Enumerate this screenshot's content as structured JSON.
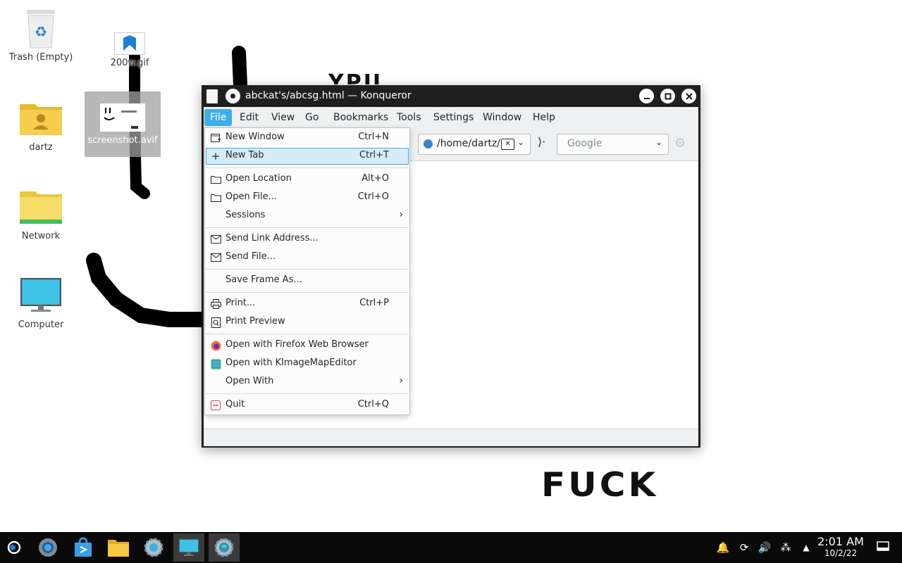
{
  "desktop": {
    "icons": [
      {
        "label": "Trash (Empty)",
        "icon": "trash-icon"
      },
      {
        "label": "200w.gif",
        "icon": "image-file-icon"
      },
      {
        "label": "screenshot.avif",
        "icon": "image-thumbnail-icon"
      },
      {
        "label": "dartz",
        "icon": "home-folder-icon"
      },
      {
        "label": "Network",
        "icon": "network-folder-icon"
      },
      {
        "label": "Computer",
        "icon": "computer-icon"
      }
    ],
    "wallpaper_text_top": "YPU",
    "wallpaper_text_bottom": "FUCK"
  },
  "window": {
    "title": "abckat's/abcsg.html — Konqueror",
    "menubar": [
      "File",
      "Edit",
      "View",
      "Go",
      "Bookmarks",
      "Tools",
      "Settings",
      "Window",
      "Help"
    ],
    "active_menu": "File",
    "location_value": "/home/dartz/D",
    "search_placeholder": "Google"
  },
  "file_menu": {
    "items": [
      {
        "label": "New Window",
        "shortcut": "Ctrl+N",
        "icon": "new-window-icon"
      },
      {
        "label": "New Tab",
        "shortcut": "Ctrl+T",
        "icon": "plus-icon"
      },
      {
        "label": "Open Location",
        "shortcut": "Alt+O",
        "icon": "folder-icon"
      },
      {
        "label": "Open File...",
        "shortcut": "Ctrl+O",
        "icon": "folder-icon"
      },
      {
        "label": "Sessions",
        "shortcut": "",
        "icon": ""
      },
      {
        "label": "Send Link Address...",
        "shortcut": "",
        "icon": "mail-link-icon"
      },
      {
        "label": "Send File...",
        "shortcut": "",
        "icon": "mail-file-icon"
      },
      {
        "label": "Save Frame As...",
        "shortcut": "",
        "icon": ""
      },
      {
        "label": "Print...",
        "shortcut": "Ctrl+P",
        "icon": "printer-icon"
      },
      {
        "label": "Print Preview",
        "shortcut": "",
        "icon": "print-preview-icon"
      },
      {
        "label": "Open with Firefox Web Browser",
        "shortcut": "",
        "icon": "firefox-icon"
      },
      {
        "label": "Open with KImageMapEditor",
        "shortcut": "",
        "icon": "kimagemapeditor-icon"
      },
      {
        "label": "Open With",
        "shortcut": "",
        "icon": ""
      },
      {
        "label": "Quit",
        "shortcut": "Ctrl+Q",
        "icon": "quit-icon"
      }
    ],
    "highlighted": "New Tab"
  },
  "taskbar": {
    "apps": [
      "application-launcher-icon",
      "discover-icon",
      "store-icon",
      "dolphin-icon",
      "system-settings-icon",
      "desktop-icon",
      "konqueror-icon"
    ],
    "time": "2:01 AM",
    "date": "10/2/22"
  },
  "colors": {
    "accent": "#3daee9",
    "highlight_bg": "#d6ecf8",
    "taskbar": "#0a0a0a",
    "menu_bg": "#fcfcfc"
  }
}
